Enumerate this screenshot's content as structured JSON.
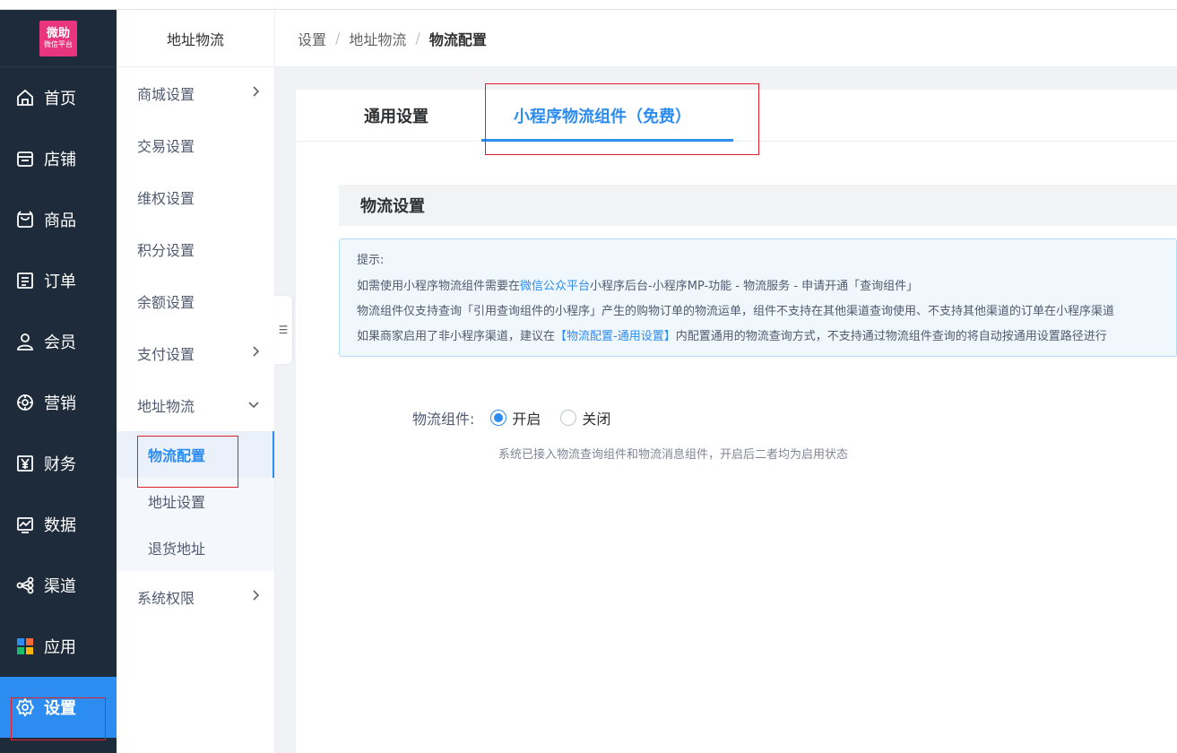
{
  "brand": {
    "logo_line1": "微助",
    "logo_line2": "微信平台",
    "accent_color": "#2d8cf0",
    "logo_color": "#e8357e"
  },
  "main_nav": {
    "items": [
      {
        "label": "首页",
        "icon": "home-icon"
      },
      {
        "label": "店铺",
        "icon": "store-icon"
      },
      {
        "label": "商品",
        "icon": "product-bag-icon"
      },
      {
        "label": "订单",
        "icon": "order-list-icon"
      },
      {
        "label": "会员",
        "icon": "user-icon"
      },
      {
        "label": "营销",
        "icon": "marketing-gear-icon"
      },
      {
        "label": "财务",
        "icon": "yen-icon"
      },
      {
        "label": "数据",
        "icon": "chart-icon"
      },
      {
        "label": "渠道",
        "icon": "share-nodes-icon"
      },
      {
        "label": "应用",
        "icon": "apps-grid-icon"
      },
      {
        "label": "设置",
        "icon": "settings-icon",
        "active": true
      }
    ]
  },
  "sub_nav": {
    "header": "地址物流",
    "items": [
      {
        "label": "商城设置",
        "chevron": "›"
      },
      {
        "label": "交易设置"
      },
      {
        "label": "维权设置"
      },
      {
        "label": "积分设置"
      },
      {
        "label": "余额设置"
      },
      {
        "label": "支付设置",
        "chevron": "›"
      },
      {
        "label": "地址物流",
        "chevron": "⌄"
      }
    ],
    "children": [
      {
        "label": "物流配置",
        "active": true
      },
      {
        "label": "地址设置"
      },
      {
        "label": "退货地址"
      }
    ],
    "last_item": {
      "label": "系统权限",
      "chevron": "›"
    },
    "collapse_glyph": "☰"
  },
  "breadcrumb": {
    "items": [
      "设置",
      "地址物流",
      "物流配置"
    ],
    "separator": "/"
  },
  "tabs": [
    {
      "label": "通用设置"
    },
    {
      "label": "小程序物流组件（免费）",
      "active": true
    }
  ],
  "section": {
    "title": "物流设置"
  },
  "alert": {
    "title": "提示:",
    "line1_pre": "如需使用小程序物流组件需要在",
    "line1_link": "微信公众平台",
    "line1_post": "小程序后台-小程序MP-功能 - 物流服务 - 申请开通「查询组件」",
    "line2": "物流组件仅支持查询「引用查询组件的小程序」产生的购物订单的物流运单，组件不支持在其他渠道查询使用、不支持其他渠道的订单在小程序渠道",
    "line3_pre": "如果商家启用了非小程序渠道，建议在",
    "line3_link": "【物流配置-通用设置】",
    "line3_post": "内配置通用的物流查询方式，不支持通过物流组件查询的将自动按通用设置路径进行"
  },
  "form": {
    "label": "物流组件:",
    "options": [
      {
        "label": "开启",
        "checked": true
      },
      {
        "label": "关闭",
        "checked": false
      }
    ],
    "help": "系统已接入物流查询组件和物流消息组件，开启后二者均为启用状态"
  }
}
